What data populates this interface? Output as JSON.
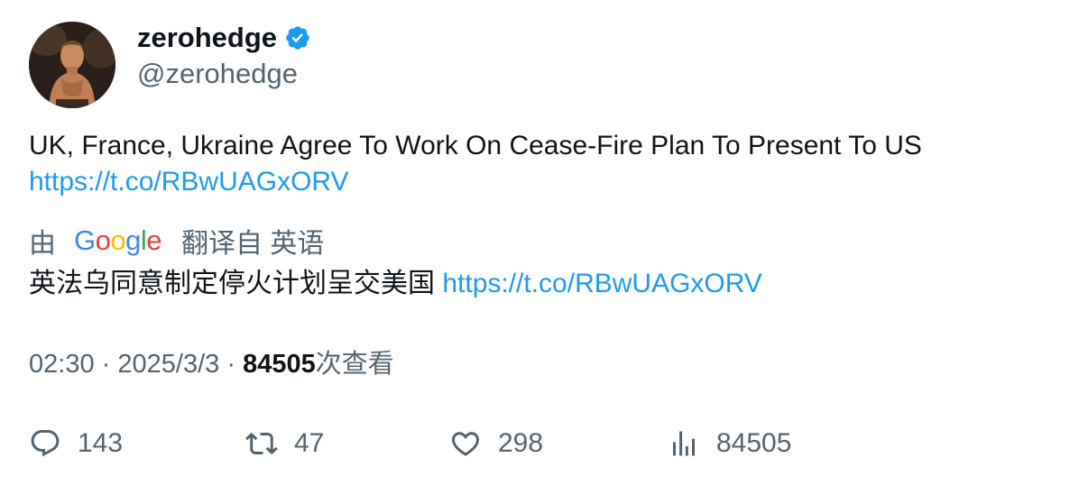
{
  "colors": {
    "text_primary": "#0f1419",
    "text_secondary": "#536471",
    "link": "#1d9bf0",
    "verified": "#1d9bf0"
  },
  "author": {
    "display_name": "zerohedge",
    "handle": "@zerohedge",
    "verified": true
  },
  "tweet": {
    "text": "UK, France, Ukraine Agree To Work On Cease-Fire Plan To Present To US",
    "link": "https://t.co/RBwUAGxORV"
  },
  "translation": {
    "prefix": "由",
    "provider": "Google",
    "suffix": "翻译自 英语",
    "text": "英法乌同意制定停火计划呈交美国",
    "link": "https://t.co/RBwUAGxORV"
  },
  "meta": {
    "time": "02:30",
    "separator": "·",
    "date": "2025/3/3",
    "views": "84505",
    "views_label": "次查看"
  },
  "actions": {
    "reply": {
      "icon": "reply-icon",
      "count": "143"
    },
    "retweet": {
      "icon": "retweet-icon",
      "count": "47"
    },
    "like": {
      "icon": "heart-icon",
      "count": "298"
    },
    "views": {
      "icon": "analytics-icon",
      "count": "84505"
    }
  }
}
